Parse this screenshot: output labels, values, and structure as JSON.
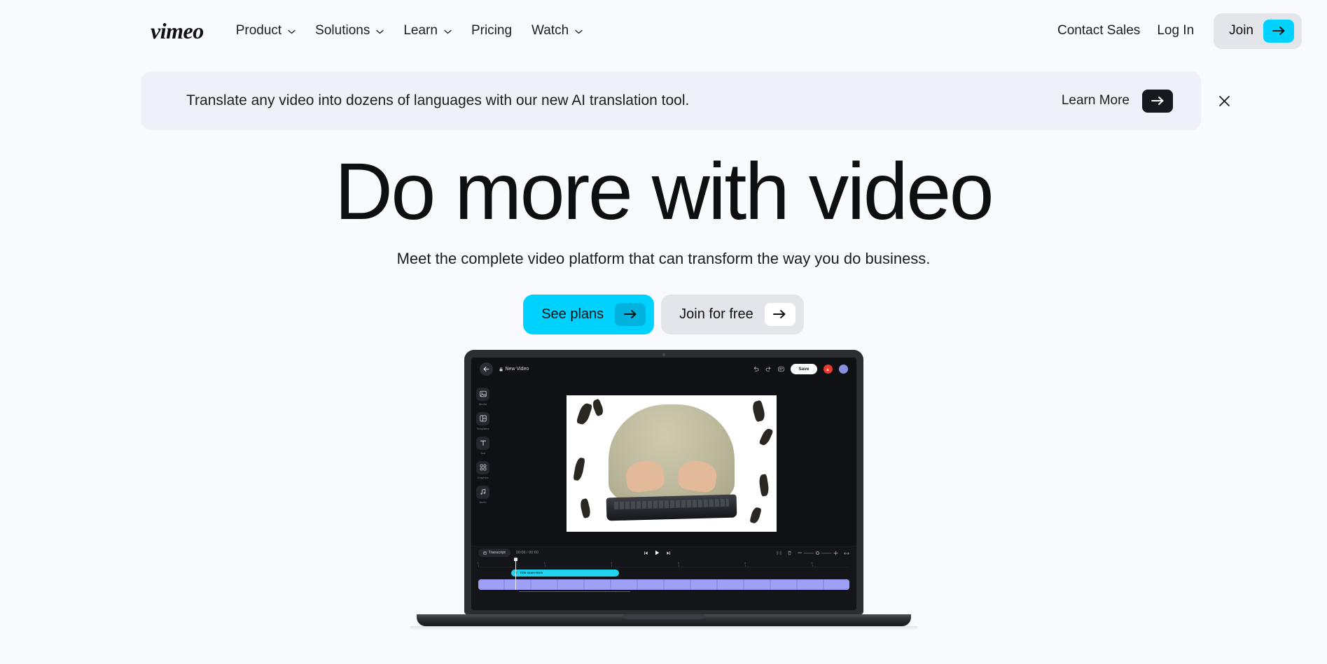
{
  "brand": {
    "logo_text": "vimeo",
    "accent_cyan": "#00d2ff",
    "accent_dark": "#15181c",
    "page_bg": "#f9fafd"
  },
  "header": {
    "nav": [
      {
        "label": "Product",
        "has_dropdown": true
      },
      {
        "label": "Solutions",
        "has_dropdown": true
      },
      {
        "label": "Learn",
        "has_dropdown": true
      },
      {
        "label": "Pricing",
        "has_dropdown": false
      },
      {
        "label": "Watch",
        "has_dropdown": true
      }
    ],
    "contact_sales": "Contact Sales",
    "log_in": "Log In",
    "join": "Join"
  },
  "banner": {
    "message": "Translate any video into dozens of languages with our new AI translation tool.",
    "cta_label": "Learn More",
    "close_label": "×"
  },
  "hero": {
    "title": "Do more with video",
    "subtitle": "Meet the complete video platform that can transform the way you do business.",
    "primary_cta": "See plans",
    "secondary_cta": "Join for free"
  },
  "editor": {
    "project_title": "New Video",
    "save_label": "Save",
    "tools": [
      {
        "label": "Media",
        "icon": "media-icon"
      },
      {
        "label": "Templates",
        "icon": "templates-icon"
      },
      {
        "label": "Text",
        "icon": "text-icon"
      },
      {
        "label": "Graphics",
        "icon": "graphics-icon"
      },
      {
        "label": "Audio",
        "icon": "audio-icon"
      }
    ],
    "timeline": {
      "transcript_label": "Transcript",
      "timecode": "00:06 / 00:60",
      "ruler_marks": [
        "0",
        "1",
        "2",
        "3",
        "4",
        "5"
      ],
      "text_clip_label": "Title Goes Here"
    }
  }
}
